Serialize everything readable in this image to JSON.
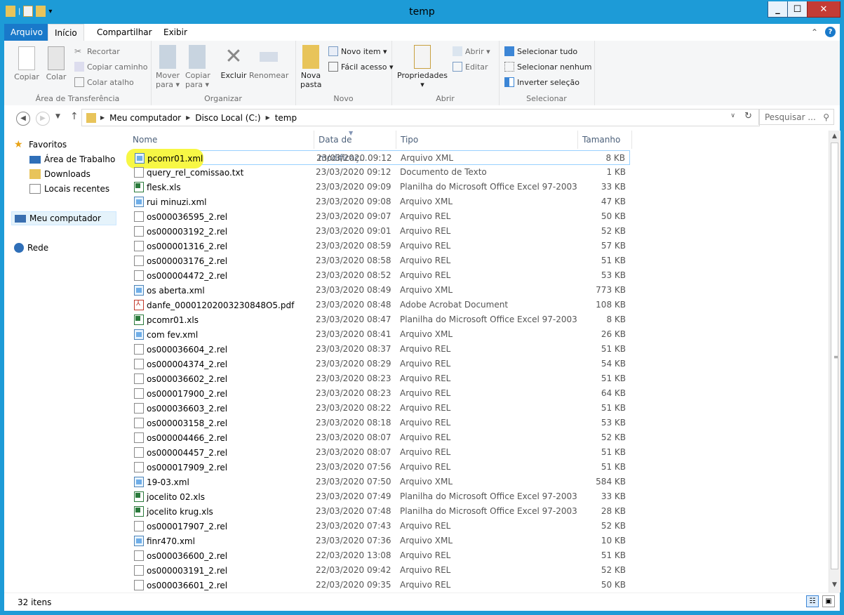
{
  "window": {
    "title": "temp"
  },
  "tabs": {
    "arquivo": "Arquivo",
    "inicio": "Início",
    "compartilhar": "Compartilhar",
    "exibir": "Exibir"
  },
  "ribbon": {
    "clipboard": {
      "copiar": "Copiar",
      "colar": "Colar",
      "recortar": "Recortar",
      "copiar_caminho": "Copiar caminho",
      "colar_atalho": "Colar atalho",
      "label": "Área de Transferência"
    },
    "organize": {
      "mover": "Mover para ▾",
      "copiar": "Copiar para ▾",
      "excluir": "Excluir",
      "renomear": "Renomear",
      "label": "Organizar"
    },
    "novo": {
      "nova_pasta": "Nova pasta",
      "novo_item": "Novo item ▾",
      "facil_acesso": "Fácil acesso ▾",
      "label": "Novo"
    },
    "abrir": {
      "propriedades": "Propriedades",
      "abrir": "Abrir ▾",
      "editar": "Editar",
      "label": "Abrir"
    },
    "selecionar": {
      "tudo": "Selecionar tudo",
      "nenhum": "Selecionar nenhum",
      "inverter": "Inverter seleção",
      "label": "Selecionar"
    }
  },
  "address": {
    "crumbs": [
      "Meu computador",
      "Disco Local (C:)",
      "temp"
    ],
    "search_placeholder": "Pesquisar ..."
  },
  "nav": {
    "favoritos": "Favoritos",
    "area_trabalho": "Área de Trabalho",
    "downloads": "Downloads",
    "locais_recentes": "Locais recentes",
    "meu_computador": "Meu computador",
    "rede": "Rede"
  },
  "columns": {
    "nome": "Nome",
    "data": "Data de modificaç...",
    "tipo": "Tipo",
    "tamanho": "Tamanho"
  },
  "files": [
    {
      "name": "pcomr01.xml",
      "date": "23/03/2020 09:12",
      "type": "Arquivo XML",
      "size": "8 KB",
      "icon": "xml"
    },
    {
      "name": "query_rel_comissao.txt",
      "date": "23/03/2020 09:12",
      "type": "Documento de Texto",
      "size": "1 KB",
      "icon": "txt"
    },
    {
      "name": "flesk.xls",
      "date": "23/03/2020 09:09",
      "type": "Planilha do Microsoft Office Excel 97-2003",
      "size": "33 KB",
      "icon": "xls"
    },
    {
      "name": "rui minuzi.xml",
      "date": "23/03/2020 09:08",
      "type": "Arquivo XML",
      "size": "47 KB",
      "icon": "xml"
    },
    {
      "name": "os000036595_2.rel",
      "date": "23/03/2020 09:07",
      "type": "Arquivo REL",
      "size": "50 KB",
      "icon": "rel"
    },
    {
      "name": "os000003192_2.rel",
      "date": "23/03/2020 09:01",
      "type": "Arquivo REL",
      "size": "52 KB",
      "icon": "rel"
    },
    {
      "name": "os000001316_2.rel",
      "date": "23/03/2020 08:59",
      "type": "Arquivo REL",
      "size": "57 KB",
      "icon": "rel"
    },
    {
      "name": "os000003176_2.rel",
      "date": "23/03/2020 08:58",
      "type": "Arquivo REL",
      "size": "51 KB",
      "icon": "rel"
    },
    {
      "name": "os000004472_2.rel",
      "date": "23/03/2020 08:52",
      "type": "Arquivo REL",
      "size": "53 KB",
      "icon": "rel"
    },
    {
      "name": "os aberta.xml",
      "date": "23/03/2020 08:49",
      "type": "Arquivo XML",
      "size": "773 KB",
      "icon": "xml"
    },
    {
      "name": "danfe_00001202003230848O5.pdf",
      "date": "23/03/2020 08:48",
      "type": "Adobe Acrobat Document",
      "size": "108 KB",
      "icon": "pdf"
    },
    {
      "name": "pcomr01.xls",
      "date": "23/03/2020 08:47",
      "type": "Planilha do Microsoft Office Excel 97-2003",
      "size": "8 KB",
      "icon": "xls"
    },
    {
      "name": "com fev.xml",
      "date": "23/03/2020 08:41",
      "type": "Arquivo XML",
      "size": "26 KB",
      "icon": "xml"
    },
    {
      "name": "os000036604_2.rel",
      "date": "23/03/2020 08:37",
      "type": "Arquivo REL",
      "size": "51 KB",
      "icon": "rel"
    },
    {
      "name": "os000004374_2.rel",
      "date": "23/03/2020 08:29",
      "type": "Arquivo REL",
      "size": "54 KB",
      "icon": "rel"
    },
    {
      "name": "os000036602_2.rel",
      "date": "23/03/2020 08:23",
      "type": "Arquivo REL",
      "size": "51 KB",
      "icon": "rel"
    },
    {
      "name": "os000017900_2.rel",
      "date": "23/03/2020 08:23",
      "type": "Arquivo REL",
      "size": "64 KB",
      "icon": "rel"
    },
    {
      "name": "os000036603_2.rel",
      "date": "23/03/2020 08:22",
      "type": "Arquivo REL",
      "size": "51 KB",
      "icon": "rel"
    },
    {
      "name": "os000003158_2.rel",
      "date": "23/03/2020 08:18",
      "type": "Arquivo REL",
      "size": "53 KB",
      "icon": "rel"
    },
    {
      "name": "os000004466_2.rel",
      "date": "23/03/2020 08:07",
      "type": "Arquivo REL",
      "size": "52 KB",
      "icon": "rel"
    },
    {
      "name": "os000004457_2.rel",
      "date": "23/03/2020 08:07",
      "type": "Arquivo REL",
      "size": "51 KB",
      "icon": "rel"
    },
    {
      "name": "os000017909_2.rel",
      "date": "23/03/2020 07:56",
      "type": "Arquivo REL",
      "size": "51 KB",
      "icon": "rel"
    },
    {
      "name": "19-03.xml",
      "date": "23/03/2020 07:50",
      "type": "Arquivo XML",
      "size": "584 KB",
      "icon": "xml"
    },
    {
      "name": "jocelito 02.xls",
      "date": "23/03/2020 07:49",
      "type": "Planilha do Microsoft Office Excel 97-2003",
      "size": "33 KB",
      "icon": "xls"
    },
    {
      "name": "jocelito krug.xls",
      "date": "23/03/2020 07:48",
      "type": "Planilha do Microsoft Office Excel 97-2003",
      "size": "28 KB",
      "icon": "xls"
    },
    {
      "name": "os000017907_2.rel",
      "date": "23/03/2020 07:43",
      "type": "Arquivo REL",
      "size": "52 KB",
      "icon": "rel"
    },
    {
      "name": "finr470.xml",
      "date": "23/03/2020 07:36",
      "type": "Arquivo XML",
      "size": "10 KB",
      "icon": "xml"
    },
    {
      "name": "os000036600_2.rel",
      "date": "22/03/2020 13:08",
      "type": "Arquivo REL",
      "size": "51 KB",
      "icon": "rel"
    },
    {
      "name": "os000003191_2.rel",
      "date": "22/03/2020 09:42",
      "type": "Arquivo REL",
      "size": "52 KB",
      "icon": "rel"
    },
    {
      "name": "os000036601_2.rel",
      "date": "22/03/2020 09:35",
      "type": "Arquivo REL",
      "size": "50 KB",
      "icon": "rel"
    }
  ],
  "status": {
    "count": "32 itens"
  }
}
